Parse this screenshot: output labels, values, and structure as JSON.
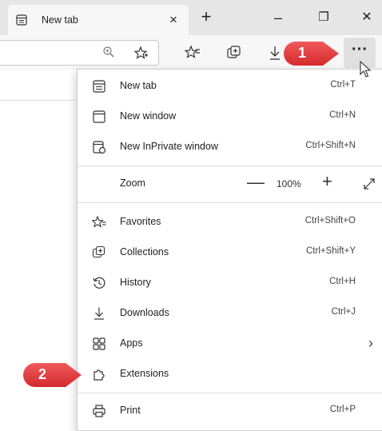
{
  "tab": {
    "title": "New tab",
    "close": "×"
  },
  "new_tab_button": "+",
  "window_controls": {
    "minimize": "–",
    "restore": "❐",
    "close": "✕"
  },
  "more_button": "···",
  "menu": {
    "items": [
      {
        "label": "New tab",
        "shortcut": "Ctrl+T",
        "icon": "new-tab-icon"
      },
      {
        "label": "New window",
        "shortcut": "Ctrl+N",
        "icon": "new-window-icon"
      },
      {
        "label": "New InPrivate window",
        "shortcut": "Ctrl+Shift+N",
        "icon": "inprivate-icon"
      },
      {
        "label": "Zoom",
        "value": "100%",
        "minus": "—",
        "plus": "+",
        "icon": "fullscreen-icon"
      },
      {
        "label": "Favorites",
        "shortcut": "Ctrl+Shift+O",
        "icon": "favorites-icon"
      },
      {
        "label": "Collections",
        "shortcut": "Ctrl+Shift+Y",
        "icon": "collections-icon"
      },
      {
        "label": "History",
        "shortcut": "Ctrl+H",
        "icon": "history-icon"
      },
      {
        "label": "Downloads",
        "shortcut": "Ctrl+J",
        "icon": "downloads-icon"
      },
      {
        "label": "Apps",
        "chevron": "›",
        "icon": "apps-icon"
      },
      {
        "label": "Extensions",
        "icon": "extensions-icon"
      },
      {
        "label": "Print",
        "shortcut": "Ctrl+P",
        "icon": "print-icon"
      }
    ]
  },
  "callouts": {
    "first": "1",
    "second": "2",
    "color": "#e8383a"
  }
}
